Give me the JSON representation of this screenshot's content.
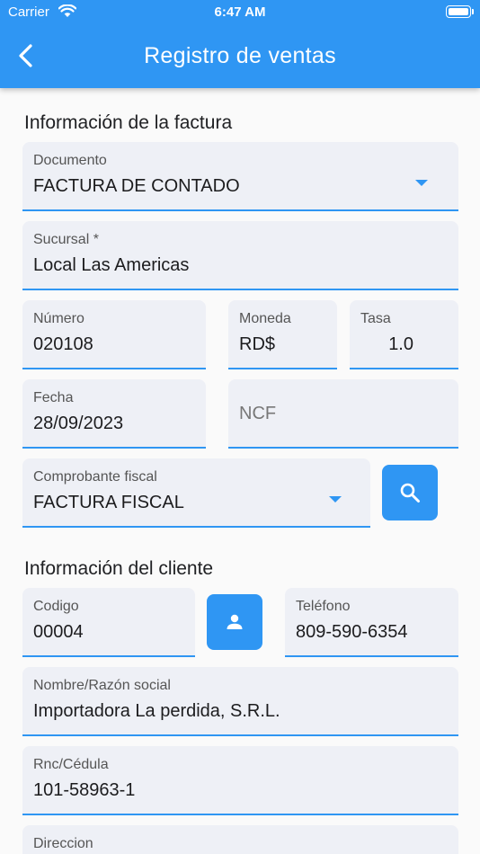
{
  "status_bar": {
    "carrier": "Carrier",
    "time": "6:47 AM"
  },
  "header": {
    "title": "Registro de ventas"
  },
  "invoice": {
    "section_title": "Información de la factura",
    "documento": {
      "label": "Documento",
      "value": "FACTURA DE CONTADO"
    },
    "sucursal": {
      "label": "Sucursal *",
      "value": "Local Las Americas"
    },
    "numero": {
      "label": "Número",
      "value": "020108"
    },
    "moneda": {
      "label": "Moneda",
      "value": "RD$"
    },
    "tasa": {
      "label": "Tasa",
      "value": "1.0"
    },
    "fecha": {
      "label": "Fecha",
      "value": "28/09/2023"
    },
    "ncf": {
      "placeholder": "NCF"
    },
    "comprobante": {
      "label": "Comprobante fiscal",
      "value": "FACTURA FISCAL"
    }
  },
  "client": {
    "section_title": "Información del cliente",
    "codigo": {
      "label": "Codigo",
      "value": "00004"
    },
    "telefono": {
      "label": "Teléfono",
      "value": "809-590-6354"
    },
    "nombre": {
      "label": "Nombre/Razón social",
      "value": "Importadora La perdida, S.R.L."
    },
    "rnc": {
      "label": "Rnc/Cédula",
      "value": "101-58963-1"
    },
    "direccion": {
      "label": "Direccion"
    }
  },
  "icons": {
    "back": "chevron-left-icon",
    "search": "search-icon",
    "person": "person-icon",
    "dropdown": "caret-down-icon"
  },
  "colors": {
    "primary": "#2f96f3",
    "field_bg": "#eef0f6",
    "page_bg": "#fafafa"
  }
}
